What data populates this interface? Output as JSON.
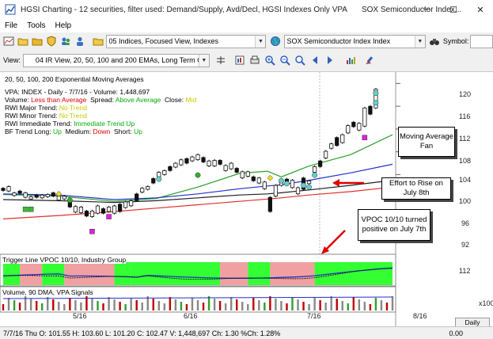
{
  "window": {
    "title": "HGSI Charting - 12 securities, filter used: Demand/Supply, Avd/Decl, HGSI Indexes Only VPA",
    "title_right": "SOX Semiconductor Index...",
    "minimize": "─",
    "maximize": "☐",
    "close": "✕"
  },
  "menu": [
    "File",
    "Tools",
    "Help"
  ],
  "toolbar1": {
    "list_dropdown": "05 Indices, Focused View, Indexes",
    "symbol_dropdown": "SOX Semiconductor Index Index",
    "symbol_label": "Symbol:"
  },
  "toolbar2": {
    "view_label": "View:",
    "view_dropdown": "04 IR View, 20, 50, 100 and 200 EMAs, Long Term Crossov"
  },
  "chart_info": {
    "line1": "20, 50, 100, 200 Exponential Moving Averages",
    "line2": "VPA: INDEX - Daily - 7/7/16 - Volume: 1,448,697",
    "vol_label": "Volume:",
    "vol_value": "Less than Average",
    "spread_label": "Spread:",
    "spread_value": "Above Average",
    "close_label": "Close:",
    "close_value": "Mid",
    "rwi_major_label": "RWI Major Trend:",
    "rwi_major_value": "No Trend",
    "rwi_minor_label": "RWI Minor Trend:",
    "rwi_minor_value": "No Trend",
    "rwi_imm_label": "RWI Immediate Trend:",
    "rwi_imm_value": "Immediate Trend Up",
    "bf_label": "BF Trend Long:",
    "bf_long": "Up",
    "bf_medium_label": "Medium:",
    "bf_medium": "Down",
    "bf_short_label": "Short:",
    "bf_short": "Up"
  },
  "callouts": {
    "ma_fan": "Moving Average Fan",
    "effort": "Effort to Rise on July 8th",
    "vpoc": "VPOC 10/10 turned positive on July 7th"
  },
  "price_axis": [
    "120",
    "116",
    "112",
    "108",
    "104",
    "100",
    "96",
    "92"
  ],
  "trigger_panel": {
    "title": "Trigger Line VPOC 10/10, Industry Group",
    "axis": "112"
  },
  "volume_panel": {
    "title": "Volume, 90 DMA, VPA Signals",
    "axis": "x100"
  },
  "date_axis": [
    "5/16",
    "6/16",
    "7/16",
    "8/16"
  ],
  "daily_button": "Daily",
  "status": {
    "text": "7/7/16 Thu O: 101.55 H: 103.60 L: 101.20 C: 102.47 V: 1,448,697 Ch: 1.30 %Ch: 1.28%",
    "right": "0.00"
  },
  "colors": {
    "ema20": "#2aa02a",
    "ema50": "#2030c8",
    "ema100": "#202020",
    "ema200": "#e03030",
    "trigger_green": "#33ff33",
    "trigger_red": "#f0a0a0",
    "arrow_red": "#e00000"
  },
  "chart_data": {
    "type": "line",
    "price_ylim": [
      90,
      122
    ],
    "ma_fan": [
      {
        "name": "ema20",
        "points": [
          [
            0,
            100.5
          ],
          [
            20,
            100.2
          ],
          [
            40,
            99.3
          ],
          [
            55,
            99.8
          ],
          [
            70,
            101.8
          ],
          [
            85,
            104.2
          ],
          [
            95,
            104.6
          ],
          [
            100,
            103.6
          ],
          [
            110,
            105.5
          ],
          [
            125,
            107.5
          ],
          [
            140,
            111.0
          ]
        ]
      },
      {
        "name": "ema50",
        "points": [
          [
            0,
            100.6
          ],
          [
            20,
            100.4
          ],
          [
            40,
            99.6
          ],
          [
            55,
            99.9
          ],
          [
            70,
            100.6
          ],
          [
            85,
            101.5
          ],
          [
            95,
            102.0
          ],
          [
            100,
            102.2
          ],
          [
            110,
            103.0
          ],
          [
            125,
            104.3
          ],
          [
            140,
            105.8
          ]
        ]
      },
      {
        "name": "ema100",
        "points": [
          [
            0,
            99.6
          ],
          [
            20,
            99.4
          ],
          [
            40,
            99.1
          ],
          [
            55,
            99.4
          ],
          [
            70,
            99.9
          ],
          [
            85,
            100.4
          ],
          [
            95,
            100.6
          ],
          [
            100,
            100.8
          ],
          [
            110,
            101.3
          ],
          [
            125,
            102.1
          ],
          [
            140,
            103.0
          ]
        ]
      },
      {
        "name": "ema200",
        "points": [
          [
            0,
            96.2
          ],
          [
            20,
            96.8
          ],
          [
            40,
            97.5
          ],
          [
            55,
            98.1
          ],
          [
            70,
            98.7
          ],
          [
            85,
            99.3
          ],
          [
            95,
            99.7
          ],
          [
            100,
            99.9
          ],
          [
            110,
            100.4
          ],
          [
            125,
            101.0
          ],
          [
            140,
            101.8
          ]
        ]
      }
    ],
    "price_bars": [
      [
        0,
        101.8,
        101.0
      ],
      [
        2,
        102.1,
        100.9
      ],
      [
        4,
        101.0,
        100.1
      ],
      [
        6,
        101.3,
        100.5
      ],
      [
        8,
        101.0,
        99.8
      ],
      [
        10,
        100.3,
        99.5
      ],
      [
        12,
        100.6,
        99.8
      ],
      [
        14,
        100.6,
        99.7
      ],
      [
        16,
        100.7,
        99.9
      ],
      [
        18,
        101.0,
        100.0
      ],
      [
        20,
        100.4,
        99.3
      ],
      [
        22,
        100.4,
        99.5
      ],
      [
        24,
        99.5,
        98.1
      ],
      [
        26,
        98.6,
        97.2
      ],
      [
        28,
        98.5,
        97.1
      ],
      [
        30,
        97.8,
        96.5
      ],
      [
        32,
        97.8,
        96.4
      ],
      [
        34,
        98.7,
        97.0
      ],
      [
        36,
        98.2,
        97.0
      ],
      [
        38,
        98.5,
        97.3
      ],
      [
        40,
        98.7,
        97.0
      ],
      [
        42,
        99.0,
        97.3
      ],
      [
        44,
        99.4,
        98.0
      ],
      [
        46,
        99.6,
        98.3
      ],
      [
        48,
        100.8,
        99.2
      ],
      [
        50,
        101.8,
        100.7
      ],
      [
        52,
        102.1,
        101.2
      ],
      [
        54,
        103.5,
        102.3
      ],
      [
        56,
        104.6,
        103.4
      ],
      [
        58,
        104.9,
        103.8
      ],
      [
        60,
        105.6,
        104.5
      ],
      [
        62,
        106.2,
        105.1
      ],
      [
        64,
        106.8,
        105.5
      ],
      [
        66,
        107.0,
        105.8
      ],
      [
        68,
        107.3,
        106.2
      ],
      [
        70,
        107.7,
        106.4
      ],
      [
        72,
        107.2,
        106.0
      ],
      [
        74,
        106.6,
        105.3
      ],
      [
        76,
        106.7,
        105.3
      ],
      [
        78,
        106.7,
        105.6
      ],
      [
        80,
        105.8,
        104.5
      ],
      [
        82,
        106.2,
        104.8
      ],
      [
        84,
        105.3,
        104.2
      ],
      [
        86,
        104.7,
        103.2
      ],
      [
        88,
        104.7,
        103.5
      ],
      [
        90,
        103.8,
        102.7
      ],
      [
        92,
        103.6,
        102.3
      ],
      [
        94,
        102.9,
        101.3
      ],
      [
        96,
        100.2,
        97.3
      ],
      [
        98,
        102.3,
        100.0
      ],
      [
        100,
        103.4,
        101.9
      ],
      [
        102,
        103.4,
        102.2
      ],
      [
        104,
        103.2,
        101.5
      ],
      [
        106,
        101.9,
        100.4
      ],
      [
        108,
        103.6,
        101.2
      ],
      [
        110,
        103.1,
        102.2
      ],
      [
        112,
        105.6,
        104.2
      ],
      [
        114,
        106.6,
        105.2
      ],
      [
        116,
        108.3,
        106.7
      ],
      [
        118,
        109.6,
        108.4
      ],
      [
        120,
        110.7,
        108.9
      ],
      [
        122,
        111.2,
        109.4
      ],
      [
        124,
        112.8,
        111.1
      ],
      [
        126,
        113.4,
        112.2
      ],
      [
        128,
        113.2,
        111.6
      ],
      [
        130,
        115.9,
        112.3
      ],
      [
        132,
        116.2,
        114.4
      ],
      [
        134,
        119.2,
        115.5
      ]
    ],
    "trigger_line_ylim": [
      100,
      120
    ],
    "volume_axis_label": "x100"
  }
}
